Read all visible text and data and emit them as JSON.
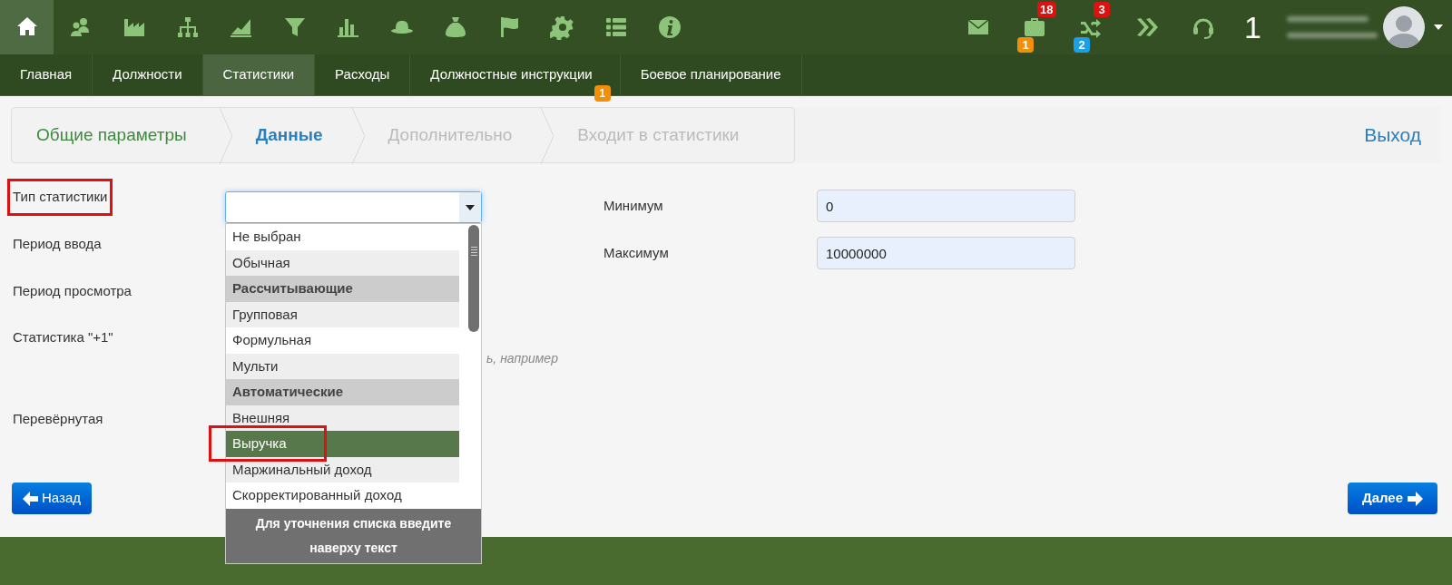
{
  "toolbar": {
    "icons": [
      {
        "kind": "home",
        "selected": true
      },
      {
        "kind": "users",
        "selected": false
      },
      {
        "kind": "factory",
        "selected": false
      },
      {
        "kind": "hierarchy",
        "selected": false
      },
      {
        "kind": "area-chart",
        "selected": false
      },
      {
        "kind": "filter",
        "selected": false
      },
      {
        "kind": "bar-chart",
        "selected": false
      },
      {
        "kind": "hat",
        "selected": false
      },
      {
        "kind": "money-bag",
        "selected": false
      },
      {
        "kind": "flag",
        "selected": false
      },
      {
        "kind": "gear",
        "selected": false
      },
      {
        "kind": "list",
        "selected": false
      },
      {
        "kind": "info",
        "selected": false
      }
    ],
    "right": [
      {
        "kind": "mail"
      },
      {
        "kind": "briefcase",
        "top_badge": {
          "text": "18",
          "color": "#e01010"
        },
        "bottom_badge": {
          "text": "1",
          "color": "#f0900a"
        }
      },
      {
        "kind": "shuffle",
        "top_badge": {
          "text": "3",
          "color": "#e01010"
        },
        "bottom_badge": {
          "text": "2",
          "color": "#1aa0e8"
        }
      },
      {
        "kind": "chevrons"
      },
      {
        "kind": "headset"
      }
    ],
    "counter": "1"
  },
  "nav": [
    {
      "label": "Главная",
      "selected": false
    },
    {
      "label": "Должности",
      "selected": false
    },
    {
      "label": "Статистики",
      "selected": true
    },
    {
      "label": "Расходы",
      "selected": false
    },
    {
      "label": "Должностные инструкции",
      "selected": false,
      "badge": "1"
    },
    {
      "label": "Боевое планирование",
      "selected": false
    }
  ],
  "steps": [
    {
      "label": "Общие параметры",
      "completed": true,
      "selected": false
    },
    {
      "label": "Данные",
      "completed": false,
      "selected": true
    },
    {
      "label": "Дополнительно",
      "completed": false,
      "selected": false
    },
    {
      "label": "Входит в статистики",
      "completed": false,
      "selected": false
    }
  ],
  "exit": "Выход",
  "form": {
    "labels": [
      {
        "text": "Тип статистики",
        "annotated": true
      },
      {
        "text": "Период ввода",
        "annotated": false
      },
      {
        "text": "Период просмотра",
        "annotated": false
      },
      {
        "text": "Статистика \"+1\"",
        "annotated": false
      },
      {
        "text": "Перевёрнутая",
        "annotated": false
      }
    ],
    "hint": "ь, например",
    "right_fields": [
      {
        "label": "Минимум",
        "value": "0"
      },
      {
        "label": "Максимум",
        "value": "10000000"
      }
    ]
  },
  "dropdown": {
    "items": [
      {
        "text": "Не выбран",
        "kind": "option",
        "selected": false,
        "annotated": false
      },
      {
        "text": "Обычная",
        "kind": "option",
        "selected": false,
        "annotated": false
      },
      {
        "text": "Рассчитывающие",
        "kind": "group",
        "selected": false,
        "annotated": false
      },
      {
        "text": "Групповая",
        "kind": "option",
        "selected": false,
        "annotated": false
      },
      {
        "text": "Формульная",
        "kind": "option",
        "selected": false,
        "annotated": false
      },
      {
        "text": "Мульти",
        "kind": "option",
        "selected": false,
        "annotated": false
      },
      {
        "text": "Автоматические",
        "kind": "group",
        "selected": false,
        "annotated": false
      },
      {
        "text": "Внешняя",
        "kind": "option",
        "selected": false,
        "annotated": false
      },
      {
        "text": "Выручка",
        "kind": "option",
        "selected": true,
        "annotated": true
      },
      {
        "text": "Маржинальный доход",
        "kind": "option",
        "selected": false,
        "annotated": false
      },
      {
        "text": "Скорректированный доход",
        "kind": "option",
        "selected": false,
        "annotated": false
      }
    ],
    "footer": "Для уточнения списка введите наверху текст"
  },
  "buttons": {
    "back": "Назад",
    "next": "Далее"
  }
}
